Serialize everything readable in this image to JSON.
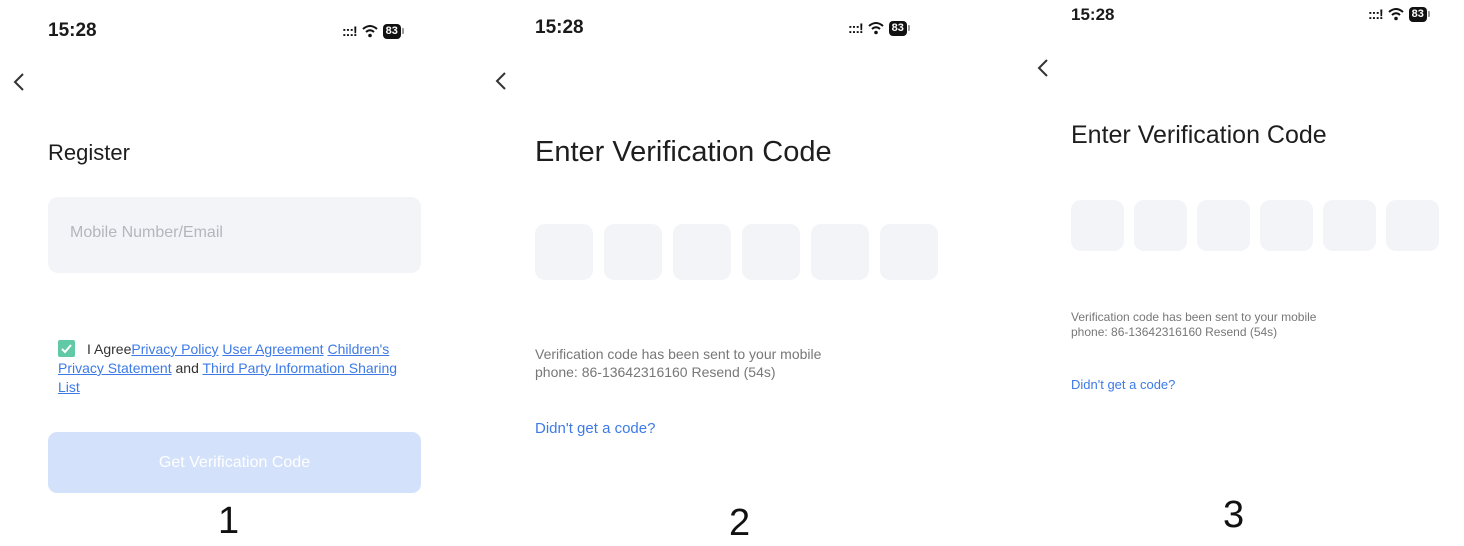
{
  "status_bar": {
    "time": "15:28",
    "signal": ":::!",
    "battery": "83"
  },
  "screen1": {
    "title": "Register",
    "input_placeholder": "Mobile Number/Email",
    "agree_prefix": "I Agree",
    "links": {
      "privacy_policy": "Privacy Policy",
      "user_agreement": "User Agreement",
      "children_privacy": "Children's Privacy Statement",
      "and": " and ",
      "third_party": "Third Party Information Sharing List"
    },
    "agree_checked": true,
    "button_label": "Get Verification Code",
    "step_number": "1"
  },
  "screen2": {
    "title": "Enter Verification Code",
    "code_length": 6,
    "hint_line1": "Verification code has been sent to your mobile",
    "hint_line2": "phone: 86-13642316160  Resend (54s)",
    "didnt_get": "Didn't get a code?",
    "step_number": "2"
  },
  "screen3": {
    "title": "Enter Verification Code",
    "code_length": 6,
    "hint_line1": "Verification code has been sent to your mobile",
    "hint_line2": "phone: 86-13642316160  Resend (54s)",
    "didnt_get": "Didn't get a code?",
    "step_number": "3"
  },
  "colors": {
    "accent_blue": "#3d7ae6",
    "checkbox_green": "#62c9a7",
    "disabled_button": "#d4e1fa",
    "field_bg": "#f3f4f8"
  },
  "icons": [
    "back-chevron-icon",
    "signal-icon",
    "wifi-icon",
    "battery-icon",
    "check-icon"
  ]
}
